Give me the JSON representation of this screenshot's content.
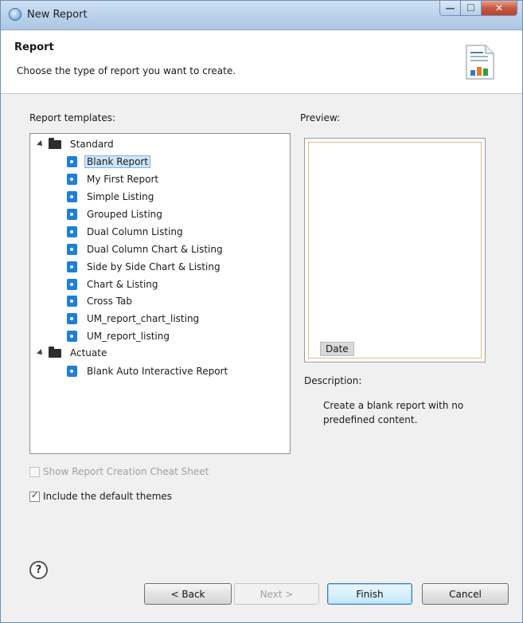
{
  "window": {
    "title": "New Report"
  },
  "header": {
    "title": "Report",
    "description": "Choose the type of report you want to create."
  },
  "templates": {
    "label": "Report templates:",
    "groups": [
      {
        "name": "Standard",
        "items": [
          "Blank Report",
          "My First Report",
          "Simple Listing",
          "Grouped Listing",
          "Dual Column Listing",
          "Dual Column Chart & Listing",
          "Side by Side Chart & Listing",
          "Chart & Listing",
          "Cross Tab",
          "UM_report_chart_listing",
          "UM_report_listing"
        ]
      },
      {
        "name": "Actuate",
        "items": [
          "Blank Auto Interactive Report"
        ]
      }
    ],
    "selected": "Blank Report"
  },
  "preview": {
    "label": "Preview:",
    "chip": "Date"
  },
  "description": {
    "label": "Description:",
    "text": "Create a blank report with no predefined content."
  },
  "options": {
    "cheat_sheet": {
      "label": "Show Report Creation Cheat Sheet",
      "checked": false,
      "enabled": false
    },
    "themes": {
      "label": "Include the default themes",
      "checked": true,
      "enabled": true
    }
  },
  "footer": {
    "help": "?",
    "back": "< Back",
    "next": "Next >",
    "finish": "Finish",
    "cancel": "Cancel"
  },
  "colors": {
    "titlebar": "#b9d1ea",
    "selection": "#cde5fb",
    "close_button": "#c75a44",
    "template_icon": "#1f7fd6"
  },
  "icons": {
    "app": "report-app-icon",
    "header": "report-wizard-icon",
    "folder": "folder-icon",
    "template": "report-template-icon"
  }
}
